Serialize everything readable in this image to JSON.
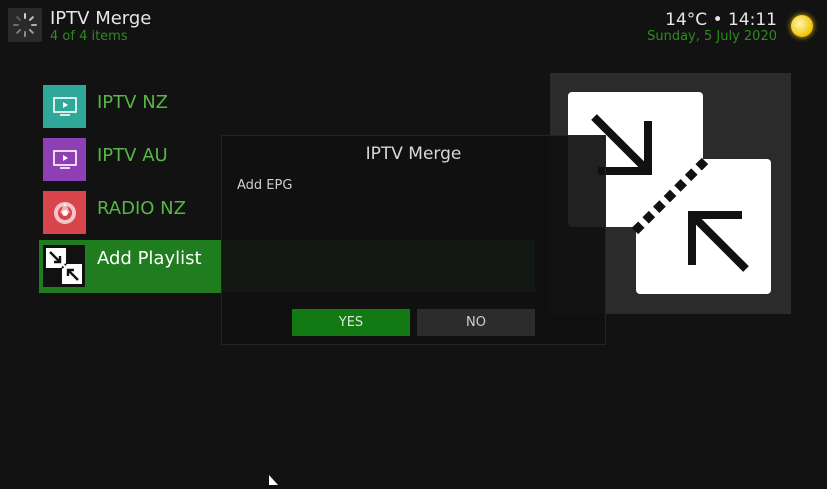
{
  "header": {
    "title": "IPTV Merge",
    "item_count": "4 of 4 items",
    "weather": "14°C • 14:11",
    "date": "Sunday, 5 July 2020",
    "icon": "spinner-icon",
    "weather_icon": "sun-icon"
  },
  "list": {
    "items": [
      {
        "label": "IPTV NZ",
        "icon": "tv-icon",
        "color": "#2fa89a"
      },
      {
        "label": "IPTV AU",
        "icon": "tv-icon",
        "color": "#8e3fb4"
      },
      {
        "label": "RADIO NZ",
        "icon": "radio-icon",
        "color": "#d9454d"
      },
      {
        "label": "Add Playlist",
        "icon": "merge-arrows-icon",
        "color": "#1f7d1f",
        "selected": true
      }
    ]
  },
  "dialog": {
    "title": "IPTV Merge",
    "message": "Add EPG",
    "yes_label": "YES",
    "no_label": "NO"
  },
  "colors": {
    "background": "#121212",
    "accent_green": "#1f7d1f",
    "secondary_text_green": "#2e8b1f"
  }
}
